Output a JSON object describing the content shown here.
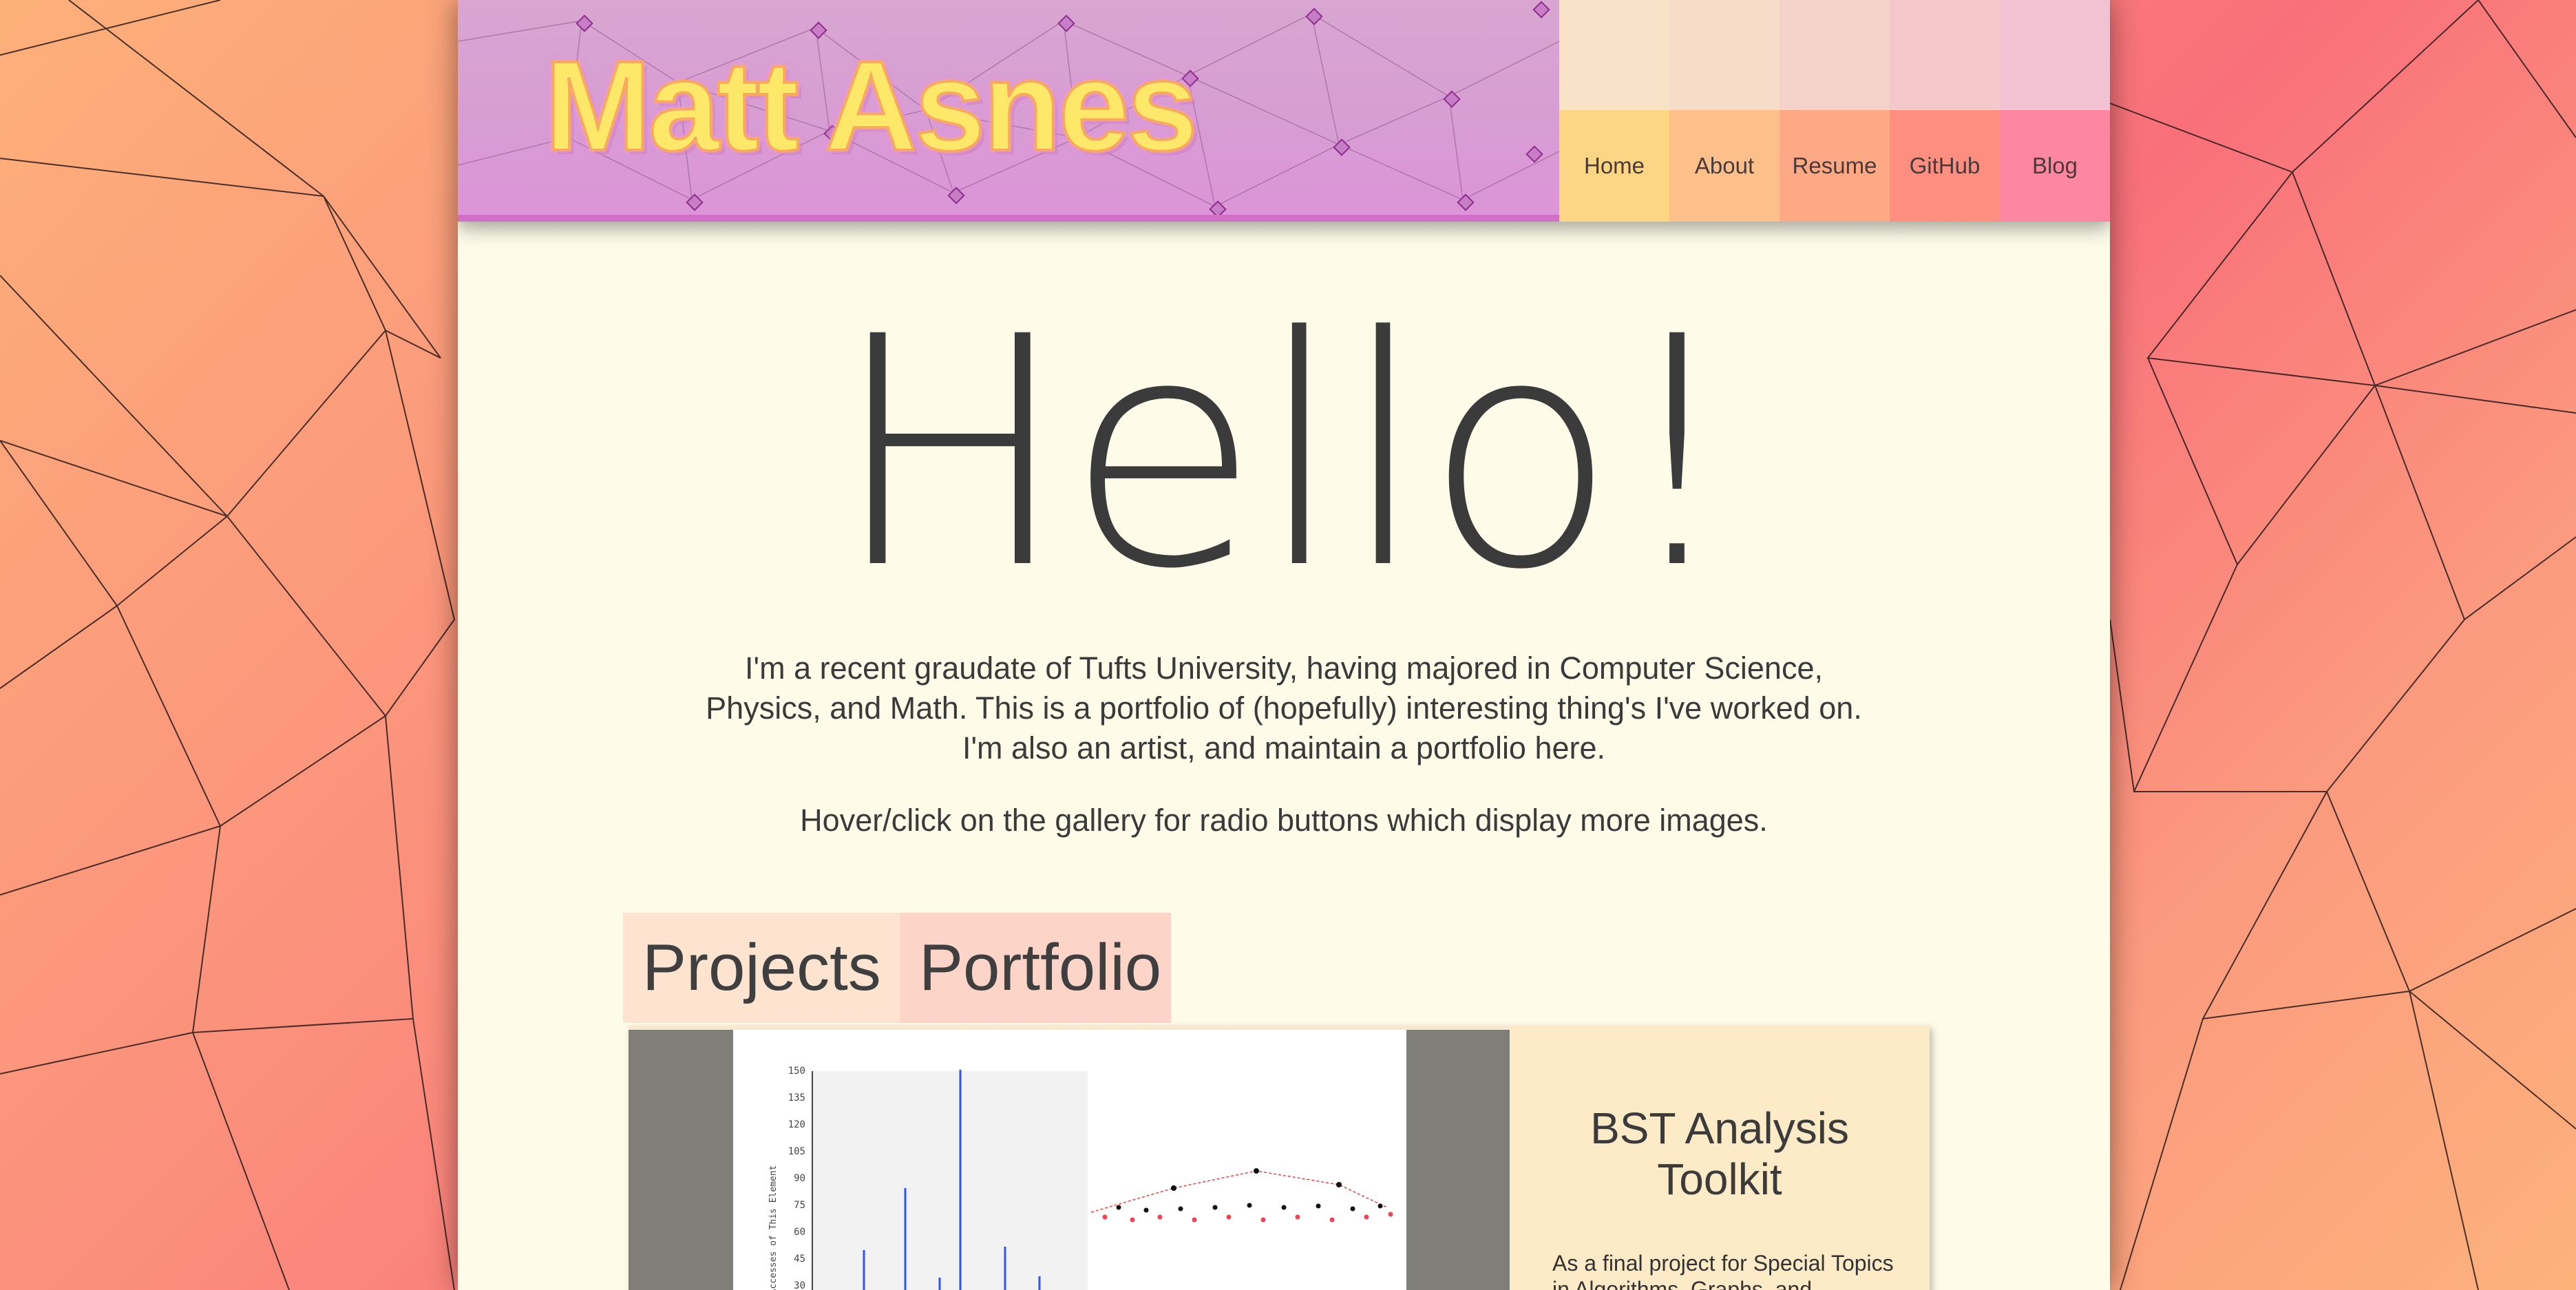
{
  "site": {
    "logo": "Matt Asnes"
  },
  "nav": {
    "items": [
      {
        "label": "Home",
        "color": "#fdd685"
      },
      {
        "label": "About",
        "color": "#fdc08a"
      },
      {
        "label": "Resume",
        "color": "#fda985"
      },
      {
        "label": "GitHub",
        "color": "#fd8e80"
      },
      {
        "label": "Blog",
        "color": "#fd87a0"
      }
    ]
  },
  "main": {
    "heading": "Hello!",
    "intro": "I'm a recent graudate of Tufts University, having majored in Computer Science, Physics, and Math. This is a portfolio of (hopefully) interesting thing's I've worked on. I'm also an artist, and maintain a portfolio here.",
    "hint": "Hover/click on the gallery for radio buttons which display more images."
  },
  "gallery": {
    "tabs": [
      "Projects",
      "Portfolio"
    ],
    "item": {
      "title": "BST Analysis Toolkit",
      "description": "As a final project for Special Topics in Algorithms, Graphs, and"
    },
    "chart": {
      "ylabel": "# Accesses of This Element",
      "yticks": [
        "150",
        "135",
        "120",
        "105",
        "90",
        "75",
        "60",
        "45",
        "30"
      ]
    }
  }
}
